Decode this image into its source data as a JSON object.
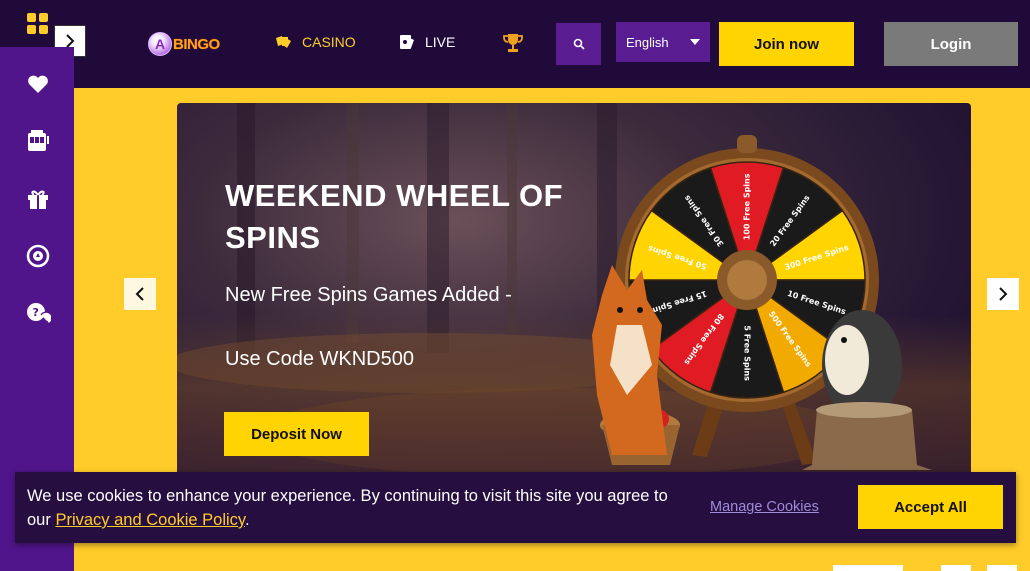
{
  "header": {
    "logo_letter": "A",
    "logo_text": "BINGO",
    "nav": [
      {
        "label": "CASINO",
        "icon": "cards-icon"
      },
      {
        "label": "LIVE",
        "icon": "live-dealer-icon"
      },
      {
        "label": "",
        "icon": "trophy-icon"
      }
    ],
    "language": "English",
    "join_label": "Join now",
    "login_label": "Login"
  },
  "sidebar": {
    "items": [
      {
        "icon": "heart-icon"
      },
      {
        "icon": "slot-machine-icon"
      },
      {
        "icon": "gift-icon"
      },
      {
        "icon": "poker-chip-icon"
      },
      {
        "icon": "help-chat-icon"
      }
    ]
  },
  "hero": {
    "title": "WEEKEND WHEEL OF SPINS",
    "line1": "New Free Spins Games Added -",
    "line2": "Use Code WKND500",
    "cta_label": "Deposit Now",
    "wheel_segments": [
      "30 Free Spins",
      "100 Free Spins",
      "20 Free Spins",
      "300 Free Spins",
      "10 Free Spins",
      "500 Free Spins",
      "5 Free Spins",
      "80 Free Spins",
      "15 Free Spins",
      "50 Free Spins"
    ]
  },
  "cookie": {
    "text": "We use cookies to enhance your experience. By continuing to visit this site you agree to our ",
    "policy_link": "Privacy and Cookie Policy",
    "text_end": ".",
    "manage_label": "Manage Cookies",
    "accept_label": "Accept All"
  },
  "colors": {
    "accent": "#ffcc29",
    "topbar": "#1f0a39",
    "sidebar": "#50158a",
    "button_yellow": "#ffd400",
    "login_gray": "#7a7a7a"
  }
}
